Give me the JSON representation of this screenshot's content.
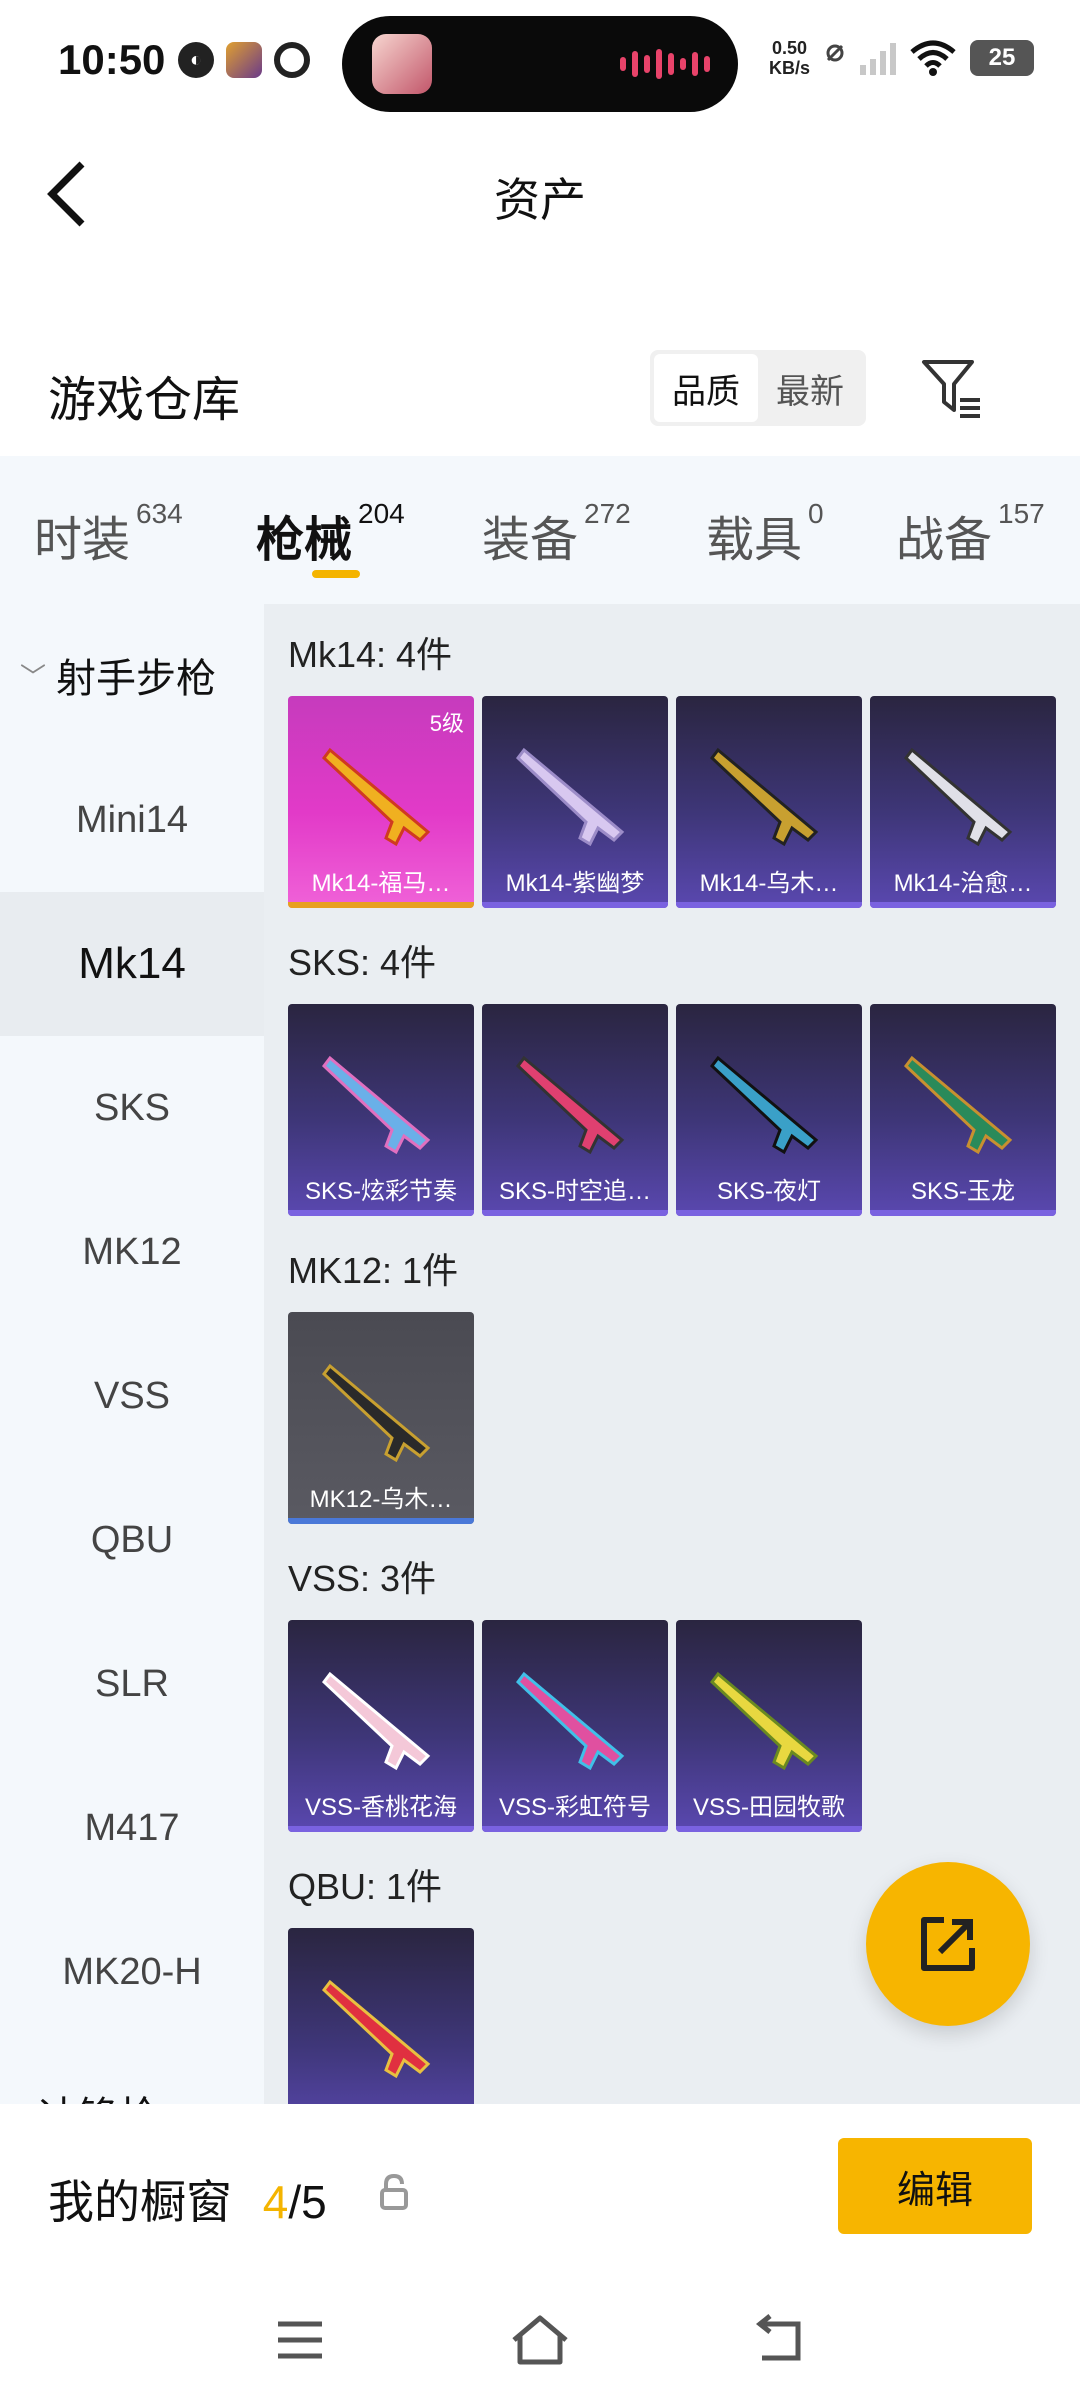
{
  "status_bar": {
    "time": "10:50",
    "speed_value": "0.50",
    "speed_unit": "KB/s",
    "battery": "25"
  },
  "header": {
    "title": "资产"
  },
  "warehouse": {
    "title": "游戏仓库",
    "sort_options": [
      "品质",
      "最新"
    ],
    "active_sort": "品质"
  },
  "tabs": [
    {
      "label": "时装",
      "count": "634"
    },
    {
      "label": "枪械",
      "count": "204"
    },
    {
      "label": "装备",
      "count": "272"
    },
    {
      "label": "载具",
      "count": "0"
    },
    {
      "label": "战备",
      "count": "157"
    }
  ],
  "active_tab": "枪械",
  "sidebar": {
    "group": "射手步枪",
    "items": [
      "Mini14",
      "Mk14",
      "SKS",
      "MK12",
      "VSS",
      "QBU",
      "SLR",
      "M417",
      "MK20-H"
    ],
    "active": "Mk14",
    "next_group": "冲锋枪"
  },
  "groups": [
    {
      "label": "Mk14: 4件",
      "items": [
        {
          "name": "Mk14-福马…",
          "level": "5级",
          "rarity": "gold"
        },
        {
          "name": "Mk14-紫幽梦",
          "rarity": "purple"
        },
        {
          "name": "Mk14-乌木…",
          "rarity": "purple"
        },
        {
          "name": "Mk14-治愈…",
          "rarity": "purple"
        }
      ]
    },
    {
      "label": "SKS: 4件",
      "items": [
        {
          "name": "SKS-炫彩节奏",
          "rarity": "purple"
        },
        {
          "name": "SKS-时空追…",
          "rarity": "purple"
        },
        {
          "name": "SKS-夜灯",
          "rarity": "purple"
        },
        {
          "name": "SKS-玉龙",
          "rarity": "purple"
        }
      ]
    },
    {
      "label": "MK12: 1件",
      "items": [
        {
          "name": "MK12-乌木…",
          "rarity": "gray"
        }
      ]
    },
    {
      "label": "VSS: 3件",
      "items": [
        {
          "name": "VSS-香桃花海",
          "rarity": "purple"
        },
        {
          "name": "VSS-彩虹符号",
          "rarity": "purple"
        },
        {
          "name": "VSS-田园牧歌",
          "rarity": "purple"
        }
      ]
    },
    {
      "label": "QBU: 1件",
      "items": [
        {
          "name": "",
          "rarity": "purple"
        }
      ]
    }
  ],
  "bottom": {
    "window_label": "我的橱窗",
    "count_current": "4",
    "count_total": "/5",
    "edit_label": "编辑"
  },
  "colors": {
    "accent": "#f7b500",
    "tab_bg": "#f4f8fc",
    "main_bg": "#eaeef2"
  }
}
